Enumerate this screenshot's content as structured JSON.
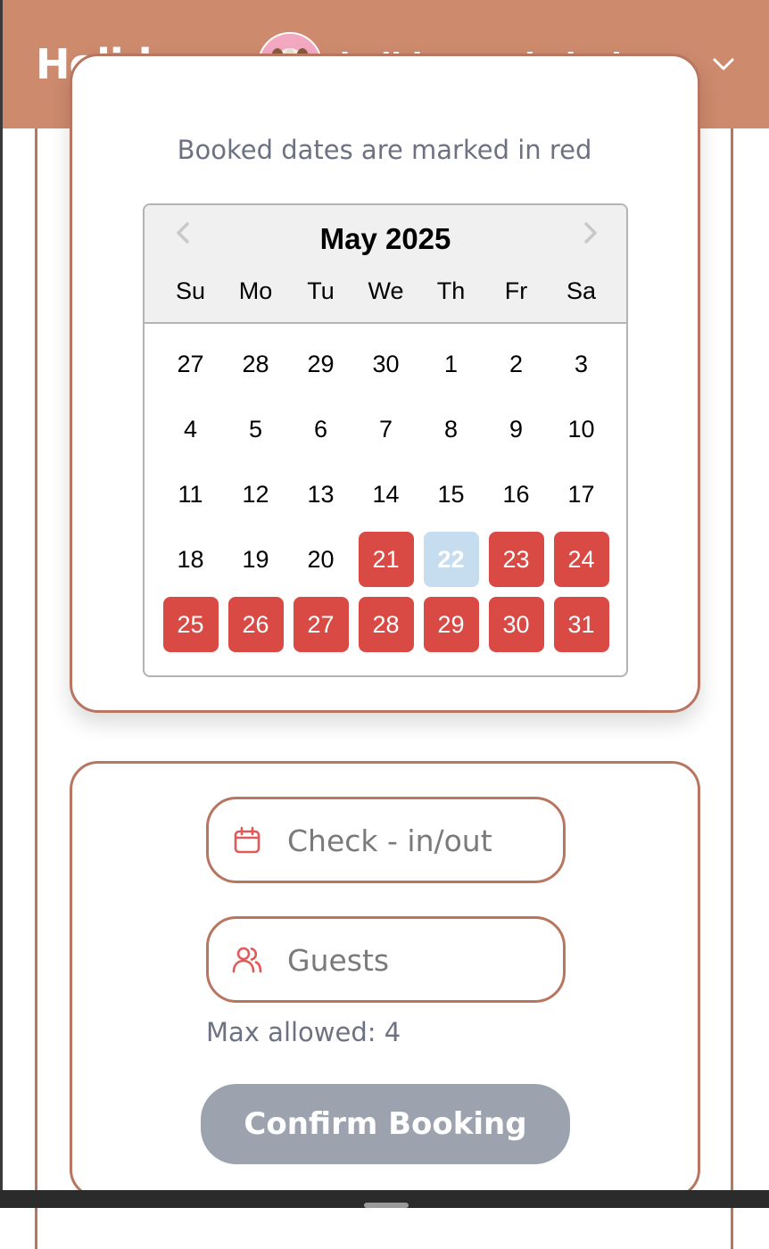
{
  "header": {
    "brand": "Holidaze",
    "username": "holidaze_admin_lyn"
  },
  "availability": {
    "hint": "Booked dates are marked in red"
  },
  "calendar": {
    "month_label": "May 2025",
    "weekdays": [
      "Su",
      "Mo",
      "Tu",
      "We",
      "Th",
      "Fr",
      "Sa"
    ],
    "weeks": [
      [
        {
          "day": "27",
          "state": "normal"
        },
        {
          "day": "28",
          "state": "normal"
        },
        {
          "day": "29",
          "state": "normal"
        },
        {
          "day": "30",
          "state": "normal"
        },
        {
          "day": "1",
          "state": "normal"
        },
        {
          "day": "2",
          "state": "normal"
        },
        {
          "day": "3",
          "state": "normal"
        }
      ],
      [
        {
          "day": "4",
          "state": "normal"
        },
        {
          "day": "5",
          "state": "normal"
        },
        {
          "day": "6",
          "state": "normal"
        },
        {
          "day": "7",
          "state": "normal"
        },
        {
          "day": "8",
          "state": "normal"
        },
        {
          "day": "9",
          "state": "normal"
        },
        {
          "day": "10",
          "state": "normal"
        }
      ],
      [
        {
          "day": "11",
          "state": "normal"
        },
        {
          "day": "12",
          "state": "normal"
        },
        {
          "day": "13",
          "state": "normal"
        },
        {
          "day": "14",
          "state": "normal"
        },
        {
          "day": "15",
          "state": "normal"
        },
        {
          "day": "16",
          "state": "normal"
        },
        {
          "day": "17",
          "state": "normal"
        }
      ],
      [
        {
          "day": "18",
          "state": "normal"
        },
        {
          "day": "19",
          "state": "normal"
        },
        {
          "day": "20",
          "state": "normal"
        },
        {
          "day": "21",
          "state": "booked"
        },
        {
          "day": "22",
          "state": "today"
        },
        {
          "day": "23",
          "state": "booked"
        },
        {
          "day": "24",
          "state": "booked"
        }
      ],
      [
        {
          "day": "25",
          "state": "booked"
        },
        {
          "day": "26",
          "state": "booked"
        },
        {
          "day": "27",
          "state": "booked"
        },
        {
          "day": "28",
          "state": "booked"
        },
        {
          "day": "29",
          "state": "booked"
        },
        {
          "day": "30",
          "state": "booked"
        },
        {
          "day": "31",
          "state": "booked"
        }
      ]
    ]
  },
  "booking": {
    "checkin_placeholder": "Check - in/out",
    "guests_placeholder": "Guests",
    "max_note": "Max allowed: 4",
    "confirm_label": "Confirm Booking"
  },
  "colors": {
    "header_bg": "#cd8a6d",
    "card_border": "#b87560",
    "booked": "#d94a45",
    "today": "#c6dcef",
    "icon_accent": "#e05a5a",
    "button_disabled": "#9ca3af"
  },
  "icons": {
    "checkin": "calendar-icon",
    "guests": "users-icon",
    "menu": "chevron-down-icon",
    "prev": "chevron-left-icon",
    "next": "chevron-right-icon"
  }
}
